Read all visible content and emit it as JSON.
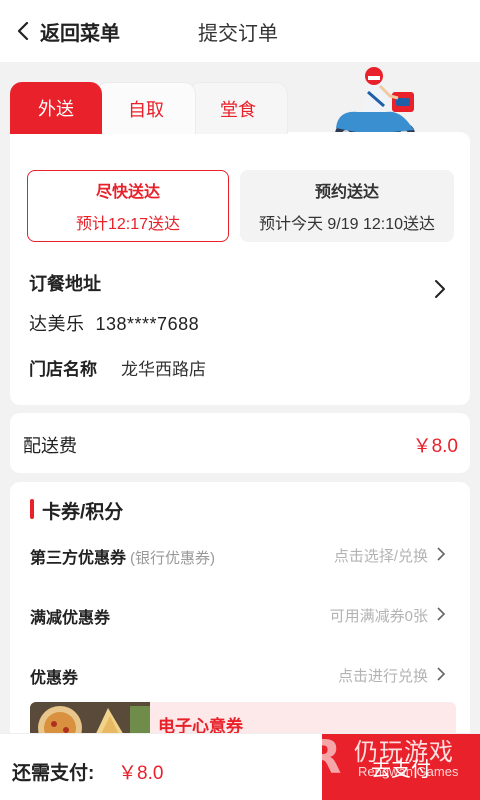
{
  "header": {
    "back_label": "返回菜单",
    "title": "提交订单"
  },
  "tabs": [
    {
      "label": "外送"
    },
    {
      "label": "自取"
    },
    {
      "label": "堂食"
    }
  ],
  "delivery_options": [
    {
      "title": "尽快送达",
      "subtitle": "预计12:17送达"
    },
    {
      "title": "预约送达",
      "subtitle": "预计今天 9/19 12:10送达"
    }
  ],
  "address": {
    "label": "订餐地址",
    "contact": "达美乐  138****7688",
    "store_label": "门店名称",
    "store_name": "龙华西路店"
  },
  "fee": {
    "label": "配送费",
    "value": "￥8.0"
  },
  "coupons": {
    "title": "卡券/积分",
    "rows": [
      {
        "label": "第三方优惠券",
        "sub": "(银行优惠券)",
        "hint": "点击选择/兑换"
      },
      {
        "label": "满减优惠券",
        "sub": "",
        "hint": "可用满减券0张"
      },
      {
        "label": "优惠券",
        "sub": "",
        "hint": "点击进行兑换"
      }
    ],
    "ecard_title": "电子心意券"
  },
  "bottom": {
    "pay_label": "还需支付:",
    "pay_amount": "￥8.0",
    "pay_button": "去支付"
  },
  "watermark": {
    "logo": "R",
    "cn": "仍玩游戏",
    "en": "Rengwan Games"
  },
  "colors": {
    "accent": "#e8212a",
    "background": "#f2f2f2"
  }
}
